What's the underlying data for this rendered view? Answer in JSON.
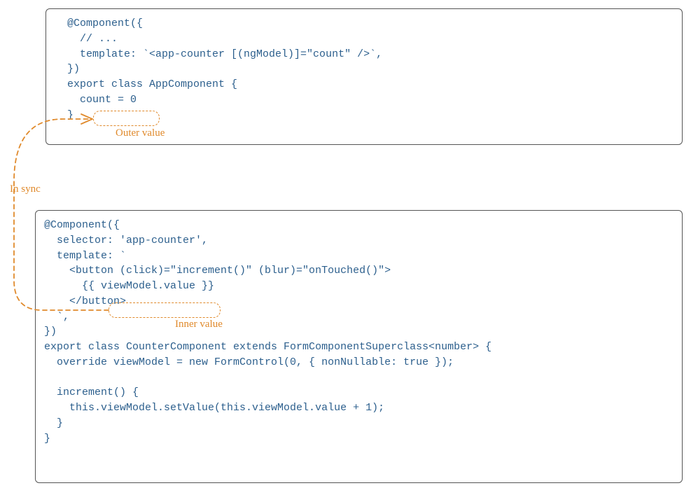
{
  "topBox": {
    "code": "  @Component({\n    // ...\n    template: `<app-counter [(ngModel)]=\"count\" />`,\n  })\n  export class AppComponent {\n    count = 0\n  }"
  },
  "bottomBox": {
    "code": "@Component({\n  selector: 'app-counter',\n  template: `\n    <button (click)=\"increment()\" (blur)=\"onTouched()\">\n      {{ viewModel.value }}\n    </button>\n  `,\n})\nexport class CounterComponent extends FormComponentSuperclass<number> {\n  override viewModel = new FormControl(0, { nonNullable: true });\n\n  increment() {\n    this.viewModel.setValue(this.viewModel.value + 1);\n  }\n}"
  },
  "annotations": {
    "inSync": "In sync",
    "outerValue": "Outer value",
    "innerValue": "Inner value"
  },
  "colors": {
    "codeText": "#2c5f8d",
    "annotation": "#e08a2c",
    "border": "#555555"
  }
}
